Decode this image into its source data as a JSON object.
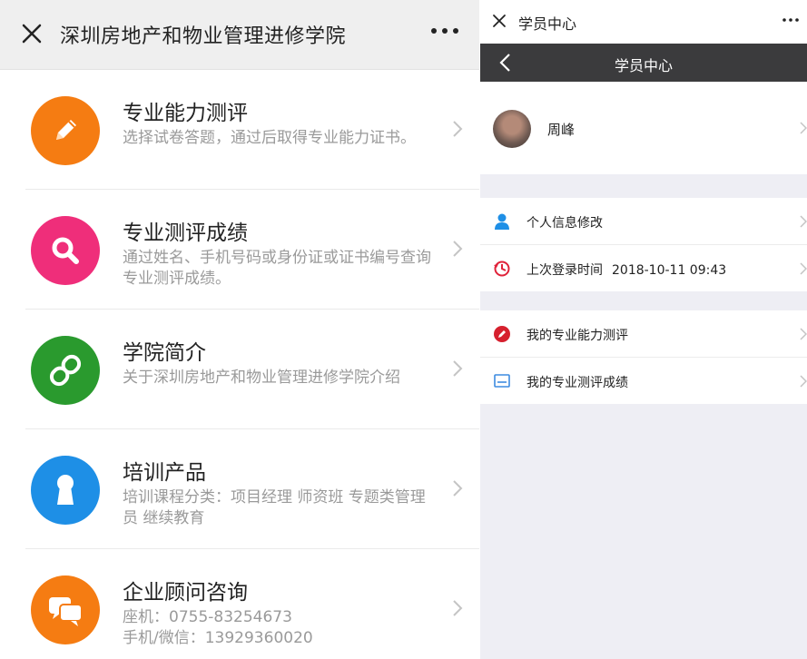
{
  "left_panel": {
    "window_title": "深圳房地产和物业管理进修学院",
    "items": [
      {
        "title": "专业能力测评",
        "desc": "选择试卷答题，通过后取得专业能力证书。",
        "icon": "pencil-icon",
        "color": "#f57c12"
      },
      {
        "title": "专业测评成绩",
        "desc": "通过姓名、手机号码或身份证或证书编号查询专业测评成绩。",
        "icon": "search-icon",
        "color": "#ef2e7a"
      },
      {
        "title": "学院简介",
        "desc": "关于深圳房地产和物业管理进修学院介绍",
        "icon": "link-icon",
        "color": "#2a9a2e"
      },
      {
        "title": "培训产品",
        "desc": "培训课程分类：项目经理 师资班 专题类管理员 继续教育",
        "icon": "keyhole-icon",
        "color": "#1e8fe6"
      },
      {
        "title": "企业顾问咨询",
        "desc_lines": [
          "座机：0755-83254673",
          "手机/微信：13929360020"
        ],
        "icon": "chat-icon",
        "color": "#f57c12"
      }
    ]
  },
  "right_panel": {
    "window_title": "学员中心",
    "nav_title": "学员中心",
    "profile_name": "周峰",
    "group1": [
      {
        "label": "个人信息修改",
        "icon": "user-icon",
        "color": "#1e8fe6"
      },
      {
        "label": "上次登录时间",
        "value": "2018-10-11 09:43",
        "icon": "history-icon",
        "color": "#e0233a"
      }
    ],
    "group2": [
      {
        "label": "我的专业能力测评",
        "icon": "pencil-circle-icon",
        "color": "#d6202e"
      },
      {
        "label": "我的专业测评成绩",
        "icon": "card-icon",
        "color": "#3d8be0"
      }
    ]
  }
}
